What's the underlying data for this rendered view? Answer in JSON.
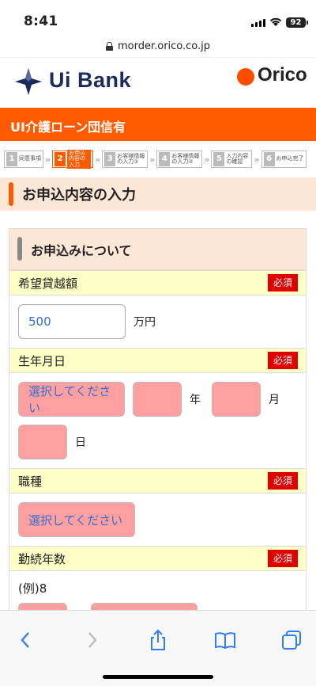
{
  "status_bar": {
    "time": "8:41",
    "battery": "92"
  },
  "browser": {
    "url": "morder.orico.co.jp"
  },
  "header": {
    "logo_text": "Bank",
    "logo_prefix": "Ui",
    "partner_logo": "Orico"
  },
  "product_bar": {
    "title": "UI介護ローン団信有"
  },
  "steps": [
    {
      "num": "1",
      "label": "同意事項"
    },
    {
      "num": "2",
      "label": "お申込内容の入力"
    },
    {
      "num": "3",
      "label": "お客様情報の入力①"
    },
    {
      "num": "4",
      "label": "お客様情報の入力②"
    },
    {
      "num": "5",
      "label": "入力内容の確認"
    },
    {
      "num": "6",
      "label": "お申込完了"
    }
  ],
  "section_title": "お申込内容の入力",
  "card_title": "お申込みについて",
  "required_label": "必須",
  "fields": {
    "loan": {
      "label": "希望貸越額",
      "value": "500",
      "unit": "万円"
    },
    "birth": {
      "label": "生年月日",
      "era_placeholder": "選択してください",
      "year_unit": "年",
      "month_unit": "月",
      "day_unit": "日"
    },
    "job": {
      "label": "職種",
      "placeholder": "選択してください"
    },
    "years": {
      "label": "勤続年数",
      "example": "(例)8"
    }
  },
  "toolbar": {
    "back": "chevron-left-icon",
    "forward": "chevron-right-icon",
    "share": "share-icon",
    "bookmarks": "book-icon",
    "tabs": "tabs-icon"
  }
}
